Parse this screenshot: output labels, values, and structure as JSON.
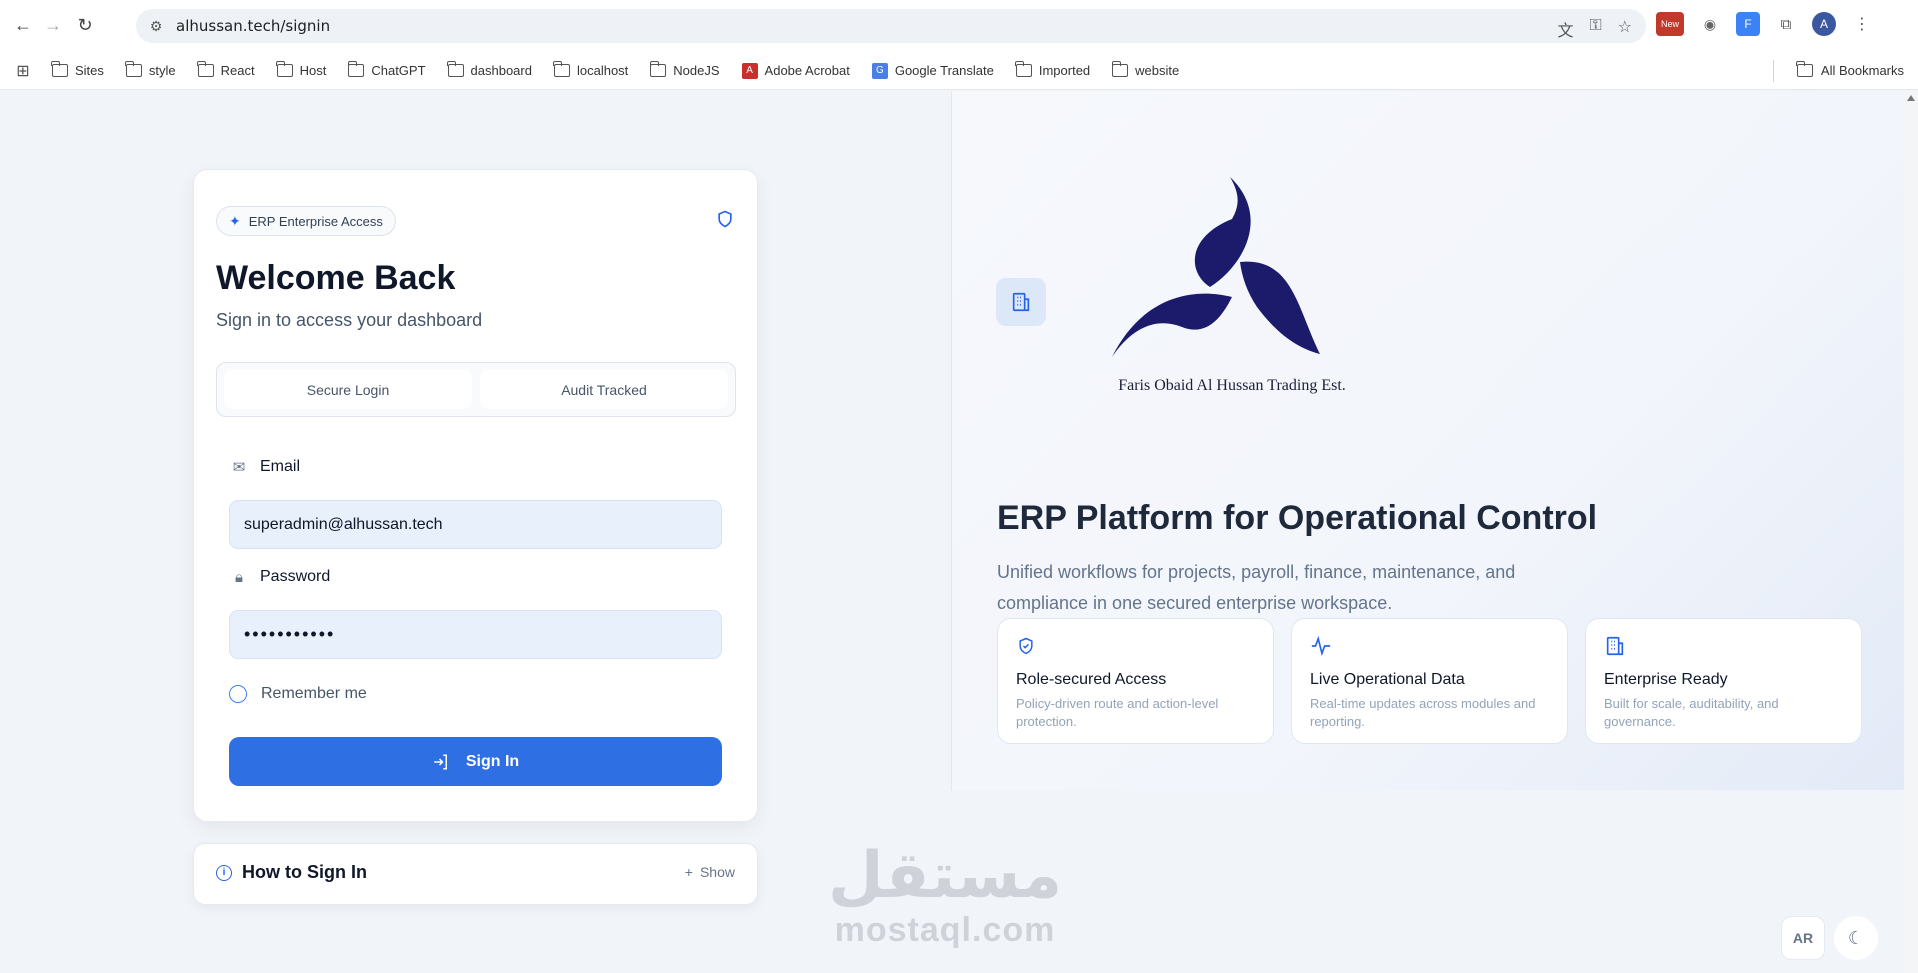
{
  "browser": {
    "url": "alhussan.tech/signin",
    "ext_new_label": "New",
    "ext_f_label": "F",
    "avatar_letter": "A"
  },
  "bookmarks": {
    "items": [
      {
        "label": "Sites",
        "icon": "folder-icon"
      },
      {
        "label": "style",
        "icon": "folder-icon"
      },
      {
        "label": "React",
        "icon": "folder-icon"
      },
      {
        "label": "Host",
        "icon": "folder-icon"
      },
      {
        "label": "ChatGPT",
        "icon": "folder-icon"
      },
      {
        "label": "dashboard",
        "icon": "folder-icon"
      },
      {
        "label": "localhost",
        "icon": "folder-icon"
      },
      {
        "label": "NodeJS",
        "icon": "folder-icon"
      },
      {
        "label": "Adobe Acrobat",
        "icon": "acrobat-icon"
      },
      {
        "label": "Google Translate",
        "icon": "google-translate-icon"
      },
      {
        "label": "Imported",
        "icon": "folder-icon"
      },
      {
        "label": "website",
        "icon": "folder-icon"
      }
    ],
    "all_bookmarks": "All Bookmarks"
  },
  "login": {
    "badge": "ERP Enterprise Access",
    "title": "Welcome Back",
    "subtitle": "Sign in to access your dashboard",
    "segments": [
      "Secure Login",
      "Audit Tracked"
    ],
    "email_label": "Email",
    "email_value": "superadmin@alhussan.tech",
    "password_label": "Password",
    "password_value": "•••••••••••",
    "remember_label": "Remember me",
    "signin_label": "Sign In"
  },
  "howto": {
    "title": "How to Sign In",
    "toggle": "Show"
  },
  "hero": {
    "company_name": "Faris Obaid Al Hussan Trading Est.",
    "title": "ERP Platform for Operational Control",
    "description": "Unified workflows for projects, payroll, finance, maintenance, and compliance in one secured enterprise workspace.",
    "features": [
      {
        "title": "Role-secured Access",
        "desc": "Policy-driven route and action-level protection.",
        "icon": "shield-check-icon"
      },
      {
        "title": "Live Operational Data",
        "desc": "Real-time updates across modules and reporting.",
        "icon": "activity-icon"
      },
      {
        "title": "Enterprise Ready",
        "desc": "Built for scale, auditability, and governance.",
        "icon": "building-icon"
      }
    ]
  },
  "watermark": {
    "arabic": "مستقل",
    "latin": "mostaql.com"
  },
  "controls": {
    "lang": "AR"
  },
  "colors": {
    "primary": "#2f6fe4",
    "logo_navy": "#1c1a6b",
    "input_bg": "#e8f0fc"
  }
}
